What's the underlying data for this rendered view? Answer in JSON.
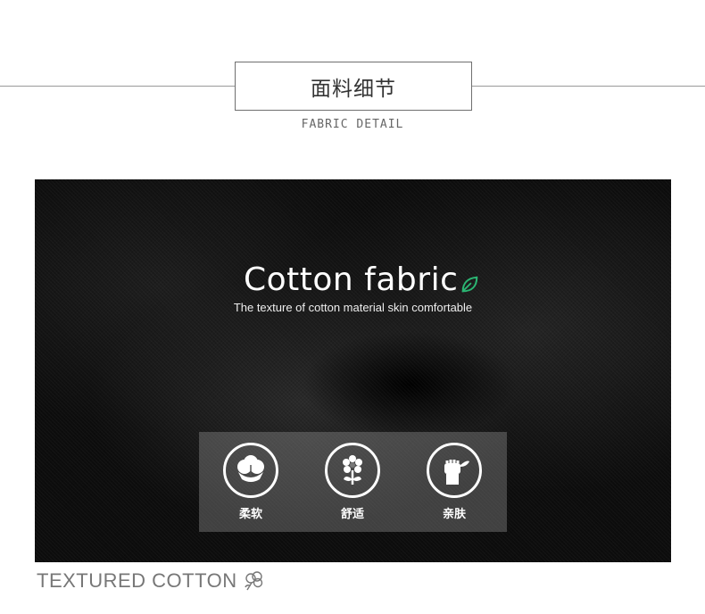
{
  "header": {
    "title": "面料细节",
    "subtitle": "FABRIC DETAIL"
  },
  "hero": {
    "heading": "Cotton fabric",
    "caption": "The texture of cotton material skin comfortable",
    "accent_color": "#2bb673"
  },
  "features": [
    {
      "icon": "cotton-boll-icon",
      "label": "柔软"
    },
    {
      "icon": "flower-icon",
      "label": "舒适"
    },
    {
      "icon": "fist-leaf-icon",
      "label": "亲肤"
    }
  ],
  "footer": {
    "label": "TEXTURED COTTON",
    "icon": "cotton-sketch-icon"
  }
}
